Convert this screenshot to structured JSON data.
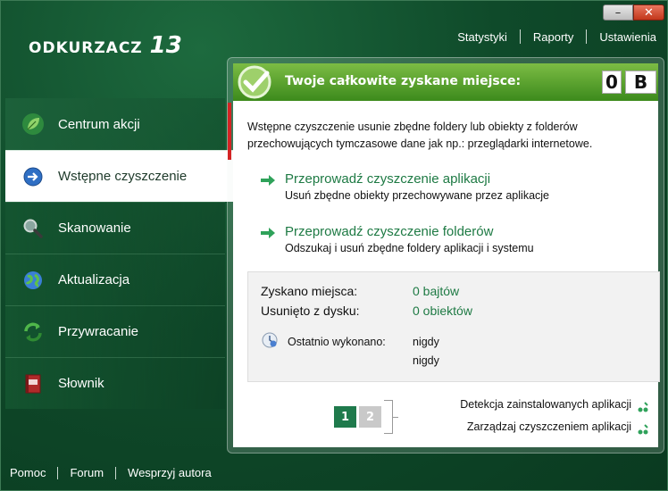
{
  "app": {
    "name": "Odkurzacz",
    "version": "13"
  },
  "window_controls": {
    "minimize": "–",
    "close": "✕"
  },
  "top_nav": [
    {
      "label": "Statystyki"
    },
    {
      "label": "Raporty"
    },
    {
      "label": "Ustawienia"
    }
  ],
  "sidebar": {
    "items": [
      {
        "label": "Centrum akcji",
        "icon": "leaf-icon"
      },
      {
        "label": "Wstępne czyszczenie",
        "icon": "arrow-circle-icon",
        "active": true
      },
      {
        "label": "Skanowanie",
        "icon": "magnifier-icon"
      },
      {
        "label": "Aktualizacja",
        "icon": "globe-icon"
      },
      {
        "label": "Przywracanie",
        "icon": "refresh-icon"
      },
      {
        "label": "Słownik",
        "icon": "book-icon"
      }
    ]
  },
  "bottom_nav": [
    {
      "label": "Pomoc"
    },
    {
      "label": "Forum"
    },
    {
      "label": "Wesprzyj autora"
    }
  ],
  "panel": {
    "header_title": "Twoje całkowite zyskane miejsce:",
    "counter_value": "0",
    "counter_unit": "B",
    "description": "Wstępne czyszczenie usunie zbędne foldery lub obiekty z folderów przechowujących tymczasowe dane jak np.: przeglądarki internetowe.",
    "actions": [
      {
        "title": "Przeprowadź czyszczenie aplikacji",
        "subtitle": "Usuń zbędne obiekty przechowywane przez aplikacje"
      },
      {
        "title": "Przeprowadź czyszczenie folderów",
        "subtitle": "Odszukaj i usuń zbędne foldery aplikacji i systemu"
      }
    ],
    "stats": {
      "gained_label": "Zyskano miejsca:",
      "gained_value": "0 bajtów",
      "removed_label": "Usunięto z dysku:",
      "removed_value": "0 obiektów",
      "last_run_label": "Ostatnio wykonano:",
      "last_run_values": [
        "nigdy",
        "nigdy"
      ]
    },
    "pager": {
      "page1": "1",
      "page2": "2"
    },
    "sub_links": [
      {
        "label": "Detekcja zainstalowanych aplikacji"
      },
      {
        "label": "Zarządzaj czyszczeniem aplikacji"
      }
    ]
  },
  "colors": {
    "accent_green": "#1e7a44",
    "header_green": "#5aa82e",
    "alert_red": "#d32424",
    "background_dark": "#0f4a2a"
  }
}
